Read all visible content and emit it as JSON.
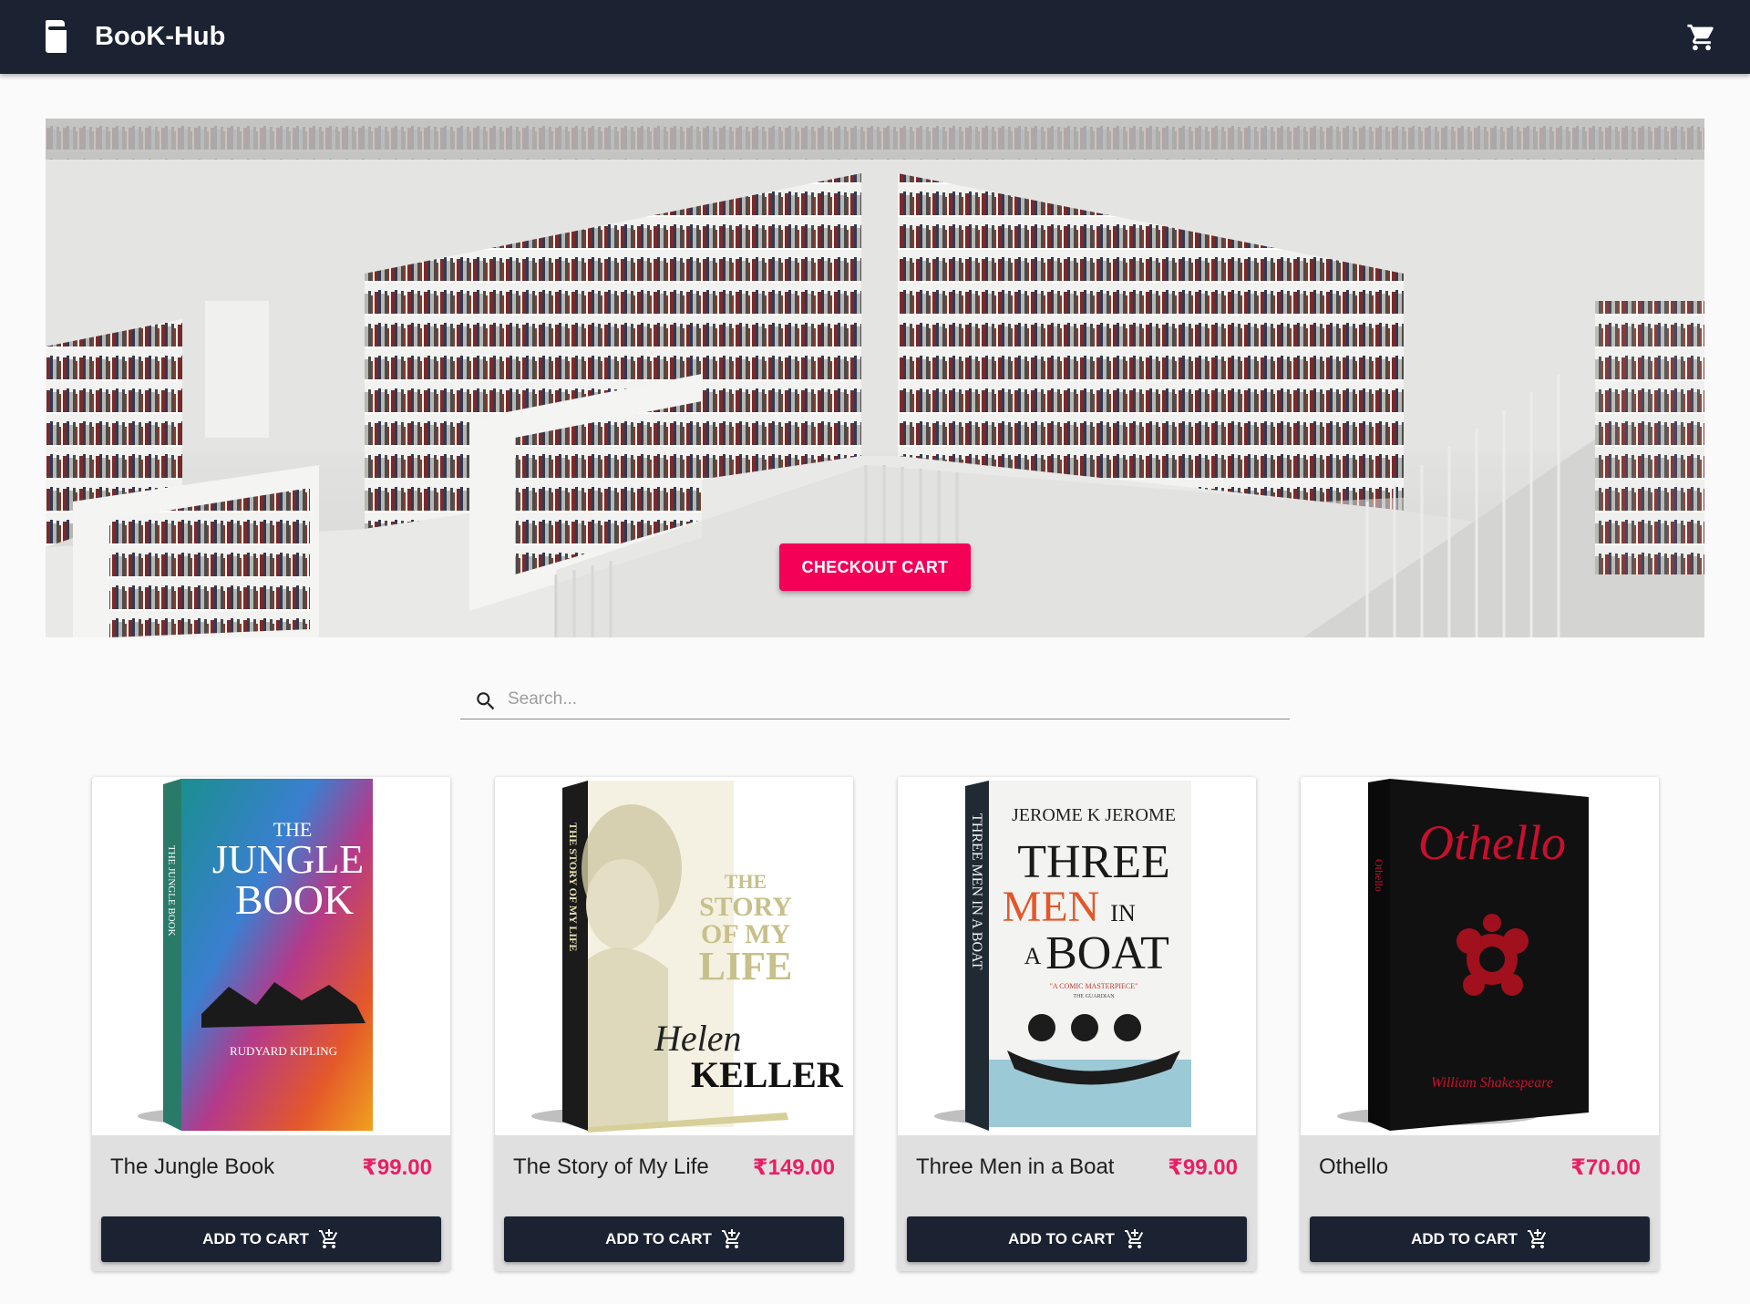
{
  "header": {
    "brand": "BooK-Hub",
    "brand_icon": "book-icon",
    "cart_icon": "cart-icon"
  },
  "hero": {
    "checkout_label": "CHECKOUT CART"
  },
  "search": {
    "placeholder": "Search...",
    "value": "",
    "icon": "search-icon"
  },
  "products": [
    {
      "title": "The Jungle Book",
      "price": "₹99.00",
      "button": "ADD TO CART",
      "cover": {
        "line1": "THE",
        "line2": "JUNGLE",
        "line3": "BOOK",
        "author": "RUDYARD KIPLING",
        "spine": "THE JUNGLE BOOK"
      }
    },
    {
      "title": "The Story of My Life",
      "price": "₹149.00",
      "button": "ADD TO CART",
      "cover": {
        "line1": "THE",
        "line2": "STORY",
        "line3": "OF MY",
        "line4": "LIFE",
        "author_first": "Helen",
        "author_last": "KELLER",
        "spine": "THE STORY OF MY LIFE"
      }
    },
    {
      "title": "Three Men in a Boat",
      "price": "₹99.00",
      "button": "ADD TO CART",
      "cover": {
        "author": "JEROME K JEROME",
        "line1": "THREE",
        "line2": "MEN",
        "line2b": "IN",
        "line3a": "A",
        "line3": "BOAT",
        "quote": "\"A COMIC MASTERPIECE\"",
        "source": "THE GUARDIAN",
        "spine": "THREE MEN IN A BOAT"
      }
    },
    {
      "title": "Othello",
      "price": "₹70.00",
      "button": "ADD TO CART",
      "cover": {
        "line1": "Othello",
        "author": "William Shakespeare",
        "spine": "Othello"
      }
    }
  ],
  "colors": {
    "appbar": "#1b2232",
    "accent": "#f50057",
    "price": "#e91e63"
  }
}
